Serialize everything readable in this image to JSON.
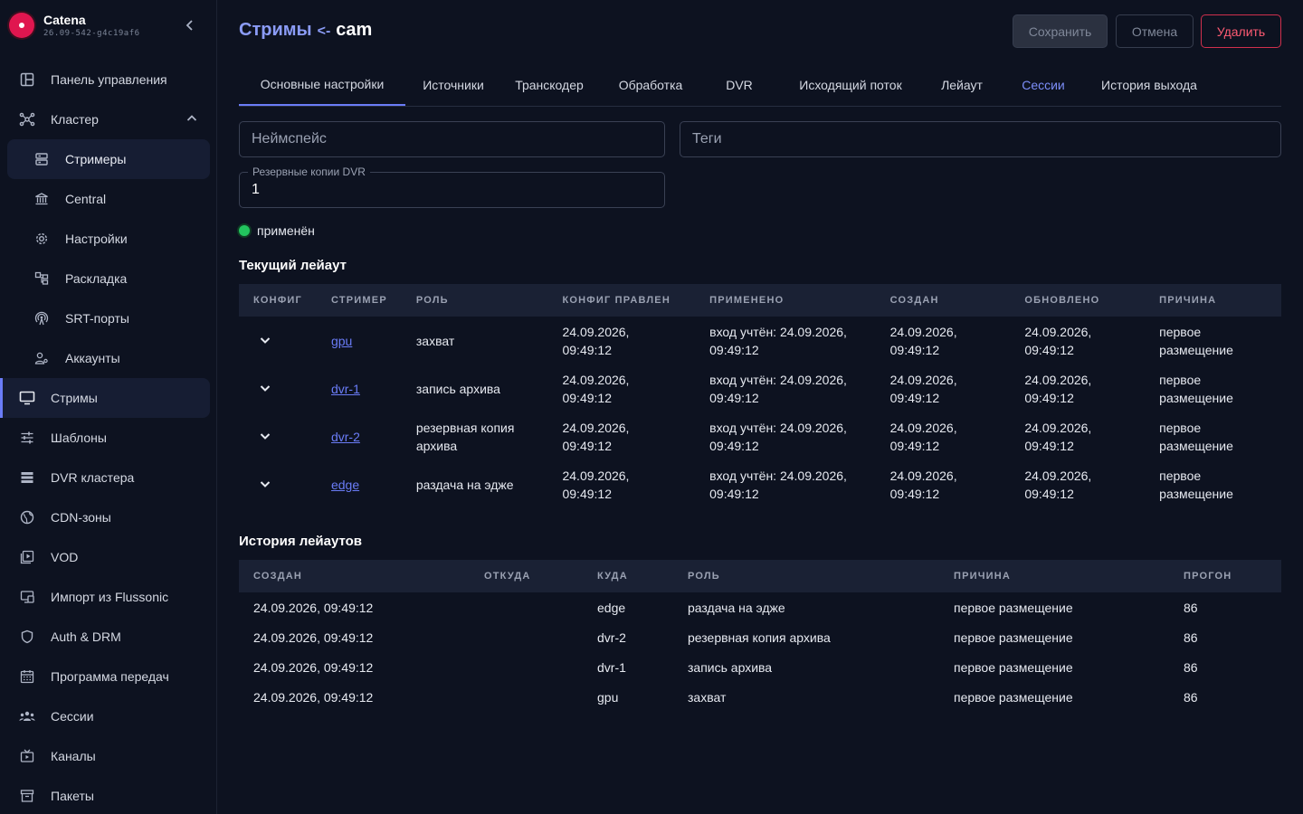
{
  "brand": {
    "name": "Catena",
    "version": "26.09-542-g4c19af6"
  },
  "sidebar": {
    "items": [
      {
        "label": "Панель управления",
        "icon": "dashboard-icon"
      },
      {
        "label": "Кластер",
        "icon": "cluster-icon",
        "expanded": true
      },
      {
        "label": "Стримеры",
        "icon": "server-icon",
        "sub": true,
        "selected": true
      },
      {
        "label": "Central",
        "icon": "bank-icon",
        "sub": true
      },
      {
        "label": "Настройки",
        "icon": "gear-icon",
        "sub": true
      },
      {
        "label": "Раскладка",
        "icon": "layout-icon",
        "sub": true
      },
      {
        "label": "SRT-порты",
        "icon": "antenna-icon",
        "sub": true
      },
      {
        "label": "Аккаунты",
        "icon": "accounts-icon",
        "sub": true
      },
      {
        "label": "Стримы",
        "icon": "monitor-icon",
        "active": true
      },
      {
        "label": "Шаблоны",
        "icon": "sliders-icon"
      },
      {
        "label": "DVR кластера",
        "icon": "storage-icon"
      },
      {
        "label": "CDN-зоны",
        "icon": "globe-icon"
      },
      {
        "label": "VOD",
        "icon": "video-library-icon"
      },
      {
        "label": "Импорт из Flussonic",
        "icon": "import-icon"
      },
      {
        "label": "Auth & DRM",
        "icon": "shield-icon"
      },
      {
        "label": "Программа передач",
        "icon": "calendar-icon"
      },
      {
        "label": "Сессии",
        "icon": "users-icon"
      },
      {
        "label": "Каналы",
        "icon": "tv-icon"
      },
      {
        "label": "Пакеты",
        "icon": "archive-icon"
      }
    ]
  },
  "header": {
    "crumb": "Стримы",
    "arrow": "<-",
    "name": "cam",
    "save_label": "Сохранить",
    "cancel_label": "Отмена",
    "delete_label": "Удалить"
  },
  "tabs": [
    "Основные настройки",
    "Источники",
    "Транскодер",
    "Обработка",
    "DVR",
    "Исходящий поток",
    "Лейаут",
    "Сессии",
    "История выхода"
  ],
  "form": {
    "namespace_placeholder": "Неймспейс",
    "tags_placeholder": "Теги",
    "dvr_label": "Резервные копии DVR",
    "dvr_value": "1"
  },
  "status": {
    "text": "применён",
    "color": "#22c55e"
  },
  "current_layout": {
    "title": "Текущий лейаут",
    "columns": [
      "Конфиг",
      "Стример",
      "Роль",
      "Конфиг правлен",
      "Применено",
      "Создан",
      "Обновлено",
      "Причина"
    ],
    "rows": [
      {
        "streamer": "gpu",
        "role": "захват",
        "config_edited": [
          "24.09.2026,",
          "09:49:12"
        ],
        "applied": [
          "вход учтён: 24.09.2026,",
          "09:49:12"
        ],
        "created": [
          "24.09.2026,",
          "09:49:12"
        ],
        "updated": [
          "24.09.2026,",
          "09:49:12"
        ],
        "reason": [
          "первое",
          "размещение"
        ]
      },
      {
        "streamer": "dvr-1",
        "role": "запись архива",
        "config_edited": [
          "24.09.2026,",
          "09:49:12"
        ],
        "applied": [
          "вход учтён: 24.09.2026,",
          "09:49:12"
        ],
        "created": [
          "24.09.2026,",
          "09:49:12"
        ],
        "updated": [
          "24.09.2026,",
          "09:49:12"
        ],
        "reason": [
          "первое",
          "размещение"
        ]
      },
      {
        "streamer": "dvr-2",
        "role": "резервная копия архива",
        "config_edited": [
          "24.09.2026,",
          "09:49:12"
        ],
        "applied": [
          "вход учтён: 24.09.2026,",
          "09:49:12"
        ],
        "created": [
          "24.09.2026,",
          "09:49:12"
        ],
        "updated": [
          "24.09.2026,",
          "09:49:12"
        ],
        "reason": [
          "первое",
          "размещение"
        ]
      },
      {
        "streamer": "edge",
        "role": "раздача на эдже",
        "config_edited": [
          "24.09.2026,",
          "09:49:12"
        ],
        "applied": [
          "вход учтён: 24.09.2026,",
          "09:49:12"
        ],
        "created": [
          "24.09.2026,",
          "09:49:12"
        ],
        "updated": [
          "24.09.2026,",
          "09:49:12"
        ],
        "reason": [
          "первое",
          "размещение"
        ]
      }
    ]
  },
  "layout_history": {
    "title": "История лейаутов",
    "columns": [
      "Создан",
      "Откуда",
      "Куда",
      "Роль",
      "Причина",
      "Прогон"
    ],
    "rows": [
      {
        "created": "24.09.2026, 09:49:12",
        "from": "",
        "to": "edge",
        "role": "раздача на эдже",
        "reason": "первое размещение",
        "run": "86"
      },
      {
        "created": "24.09.2026, 09:49:12",
        "from": "",
        "to": "dvr-2",
        "role": "резервная копия архива",
        "reason": "первое размещение",
        "run": "86"
      },
      {
        "created": "24.09.2026, 09:49:12",
        "from": "",
        "to": "dvr-1",
        "role": "запись архива",
        "reason": "первое размещение",
        "run": "86"
      },
      {
        "created": "24.09.2026, 09:49:12",
        "from": "",
        "to": "gpu",
        "role": "захват",
        "reason": "первое размещение",
        "run": "86"
      }
    ]
  }
}
